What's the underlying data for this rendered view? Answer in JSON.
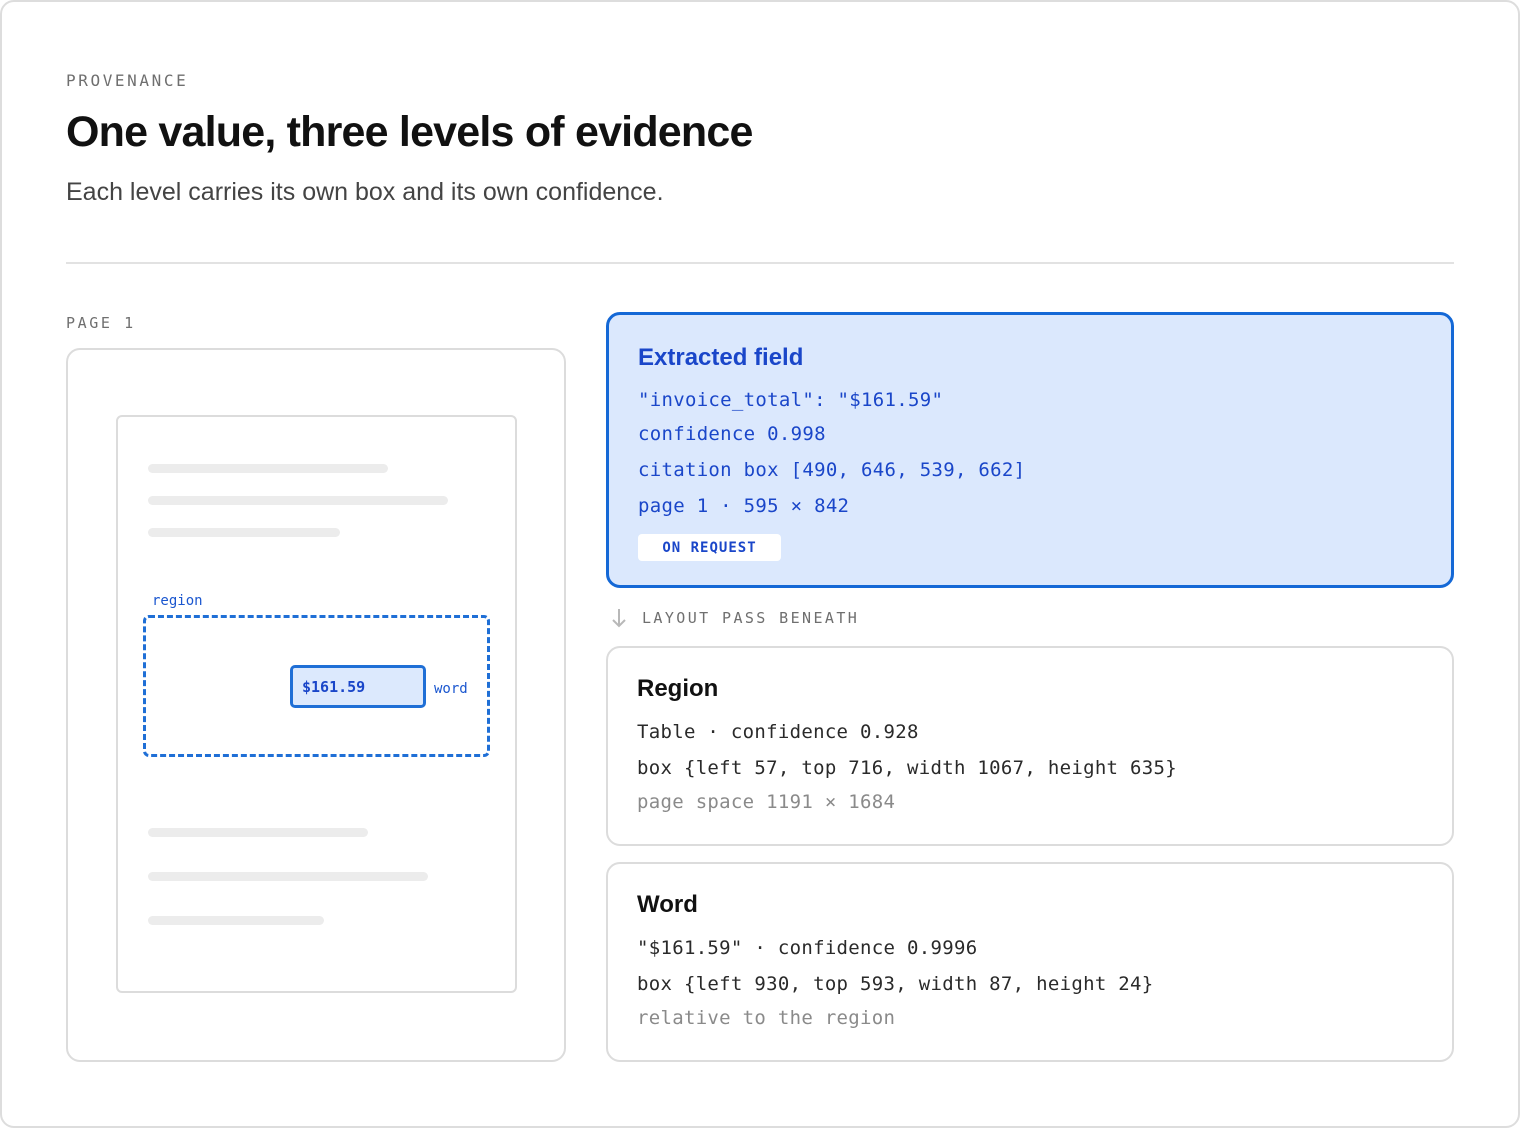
{
  "header": {
    "eyebrow": "PROVENANCE",
    "title": "One value, three levels of evidence",
    "subtitle": "Each level carries its own box and its own confidence."
  },
  "page_preview": {
    "label": "PAGE 1",
    "region_label": "region",
    "word_label": "word",
    "word_value": "$161.59"
  },
  "extracted_field": {
    "title": "Extracted field",
    "line1": "\"invoice_total\": \"$161.59\"",
    "line2": "confidence 0.998",
    "line3": "citation box [490, 646, 539, 662]",
    "line4": "page 1 · 595 × 842",
    "badge": "ON REQUEST"
  },
  "layout_pass": {
    "label": "LAYOUT PASS BENEATH"
  },
  "region_card": {
    "title": "Region",
    "line1": "Table · confidence 0.928",
    "line2": "box {left 57, top 716, width 1067, height 635}",
    "line3": "page space 1191 × 1684"
  },
  "word_card": {
    "title": "Word",
    "line1": "\"$161.59\" · confidence 0.9996",
    "line2": "box {left 930, top 593, width 87, height 24}",
    "line3": "relative to the region"
  },
  "colors": {
    "accent": "#1468d6",
    "accent_text": "#1a46c9",
    "accent_fill": "#dbe8fd",
    "border": "#dcdcdc"
  }
}
